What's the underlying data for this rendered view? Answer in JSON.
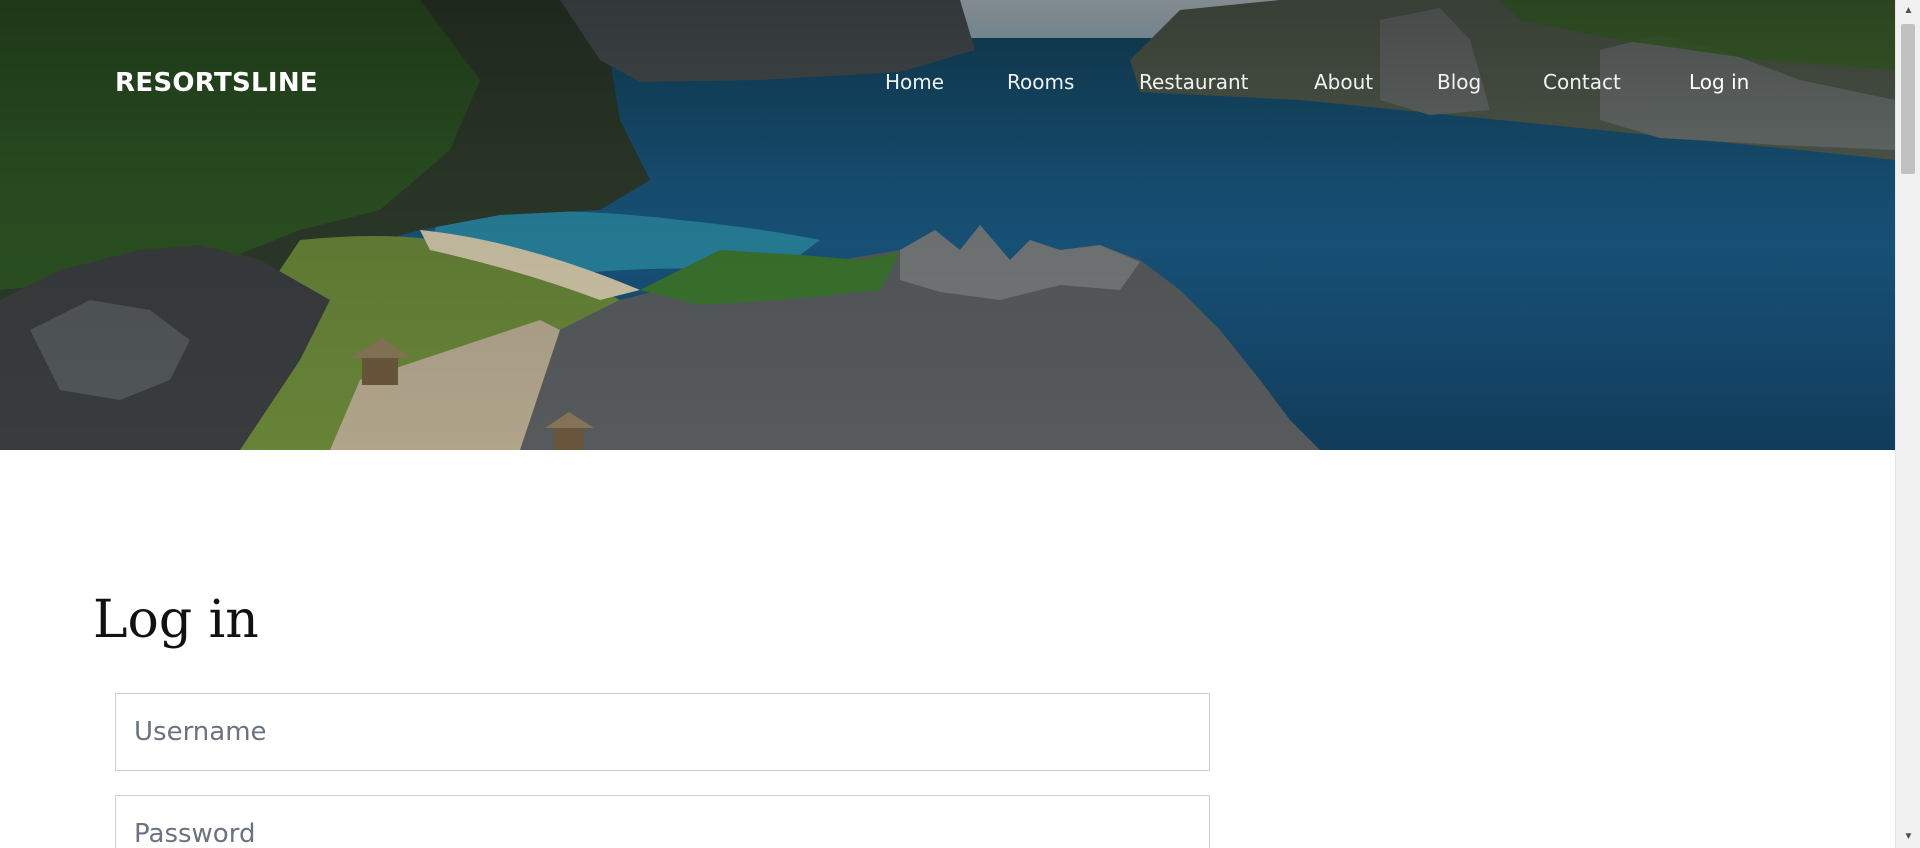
{
  "header": {
    "brand": "RESORTSLINE",
    "nav": [
      {
        "label": "Home"
      },
      {
        "label": "Rooms"
      },
      {
        "label": "Restaurant"
      },
      {
        "label": "About"
      },
      {
        "label": "Blog"
      },
      {
        "label": "Contact"
      },
      {
        "label": "Log in",
        "active": true
      }
    ]
  },
  "main": {
    "title": "Log in",
    "username_placeholder": "Username",
    "password_placeholder": "Password"
  },
  "colors": {
    "sea": "#1a5b86",
    "rock": "#4a4a4a",
    "greenery": "#3b6b2b",
    "text": "#111111"
  }
}
